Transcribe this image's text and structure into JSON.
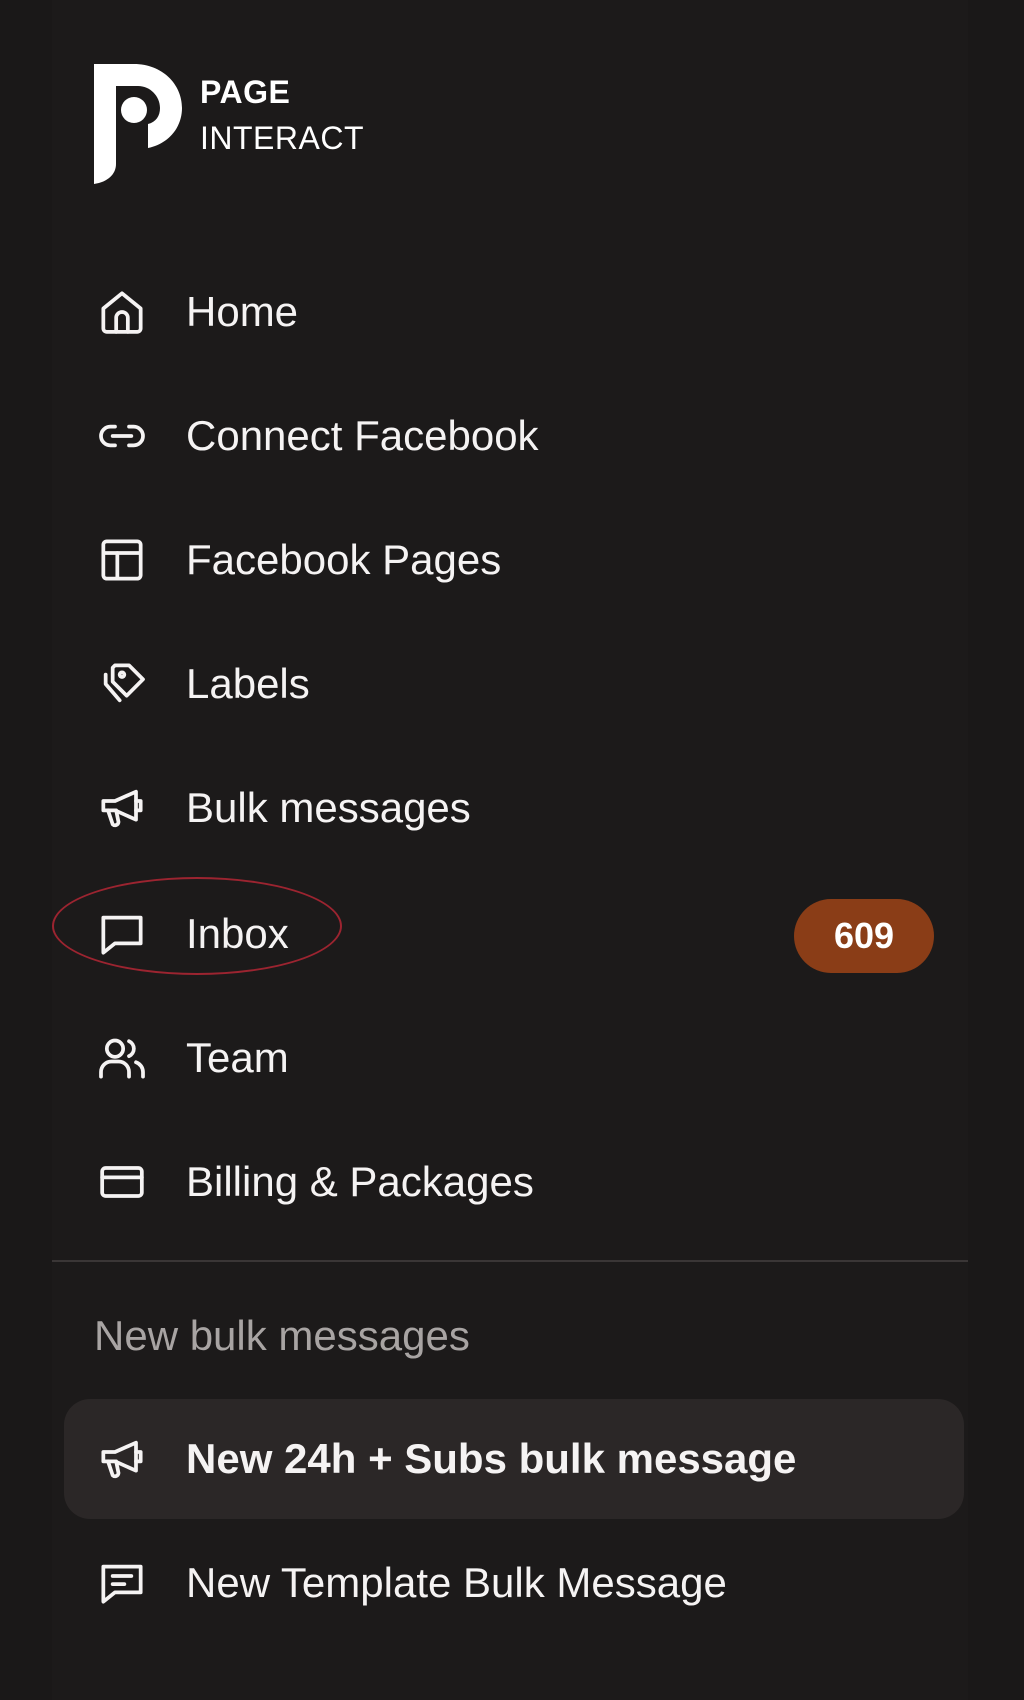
{
  "brand": {
    "line1": "PAGE",
    "line2": "INTERACT"
  },
  "nav": {
    "items": [
      {
        "label": "Home",
        "icon": "home-icon"
      },
      {
        "label": "Connect Facebook",
        "icon": "link-icon"
      },
      {
        "label": "Facebook Pages",
        "icon": "layout-icon"
      },
      {
        "label": "Labels",
        "icon": "tags-icon"
      },
      {
        "label": "Bulk messages",
        "icon": "megaphone-icon"
      },
      {
        "label": "Inbox",
        "icon": "message-square-icon",
        "badge": "609"
      },
      {
        "label": "Team",
        "icon": "users-icon"
      },
      {
        "label": "Billing & Packages",
        "icon": "credit-card-icon"
      }
    ]
  },
  "section": {
    "title": "New bulk messages",
    "items": [
      {
        "label": "New 24h + Subs bulk message",
        "icon": "megaphone-icon"
      },
      {
        "label": "New Template Bulk Message",
        "icon": "message-text-icon"
      }
    ]
  },
  "colors": {
    "background": "#1a1818",
    "badge": "#8a3d17",
    "active_item_bg": "#2b2727",
    "annotation": "#9c2430",
    "muted_text": "#a8a4a3"
  }
}
